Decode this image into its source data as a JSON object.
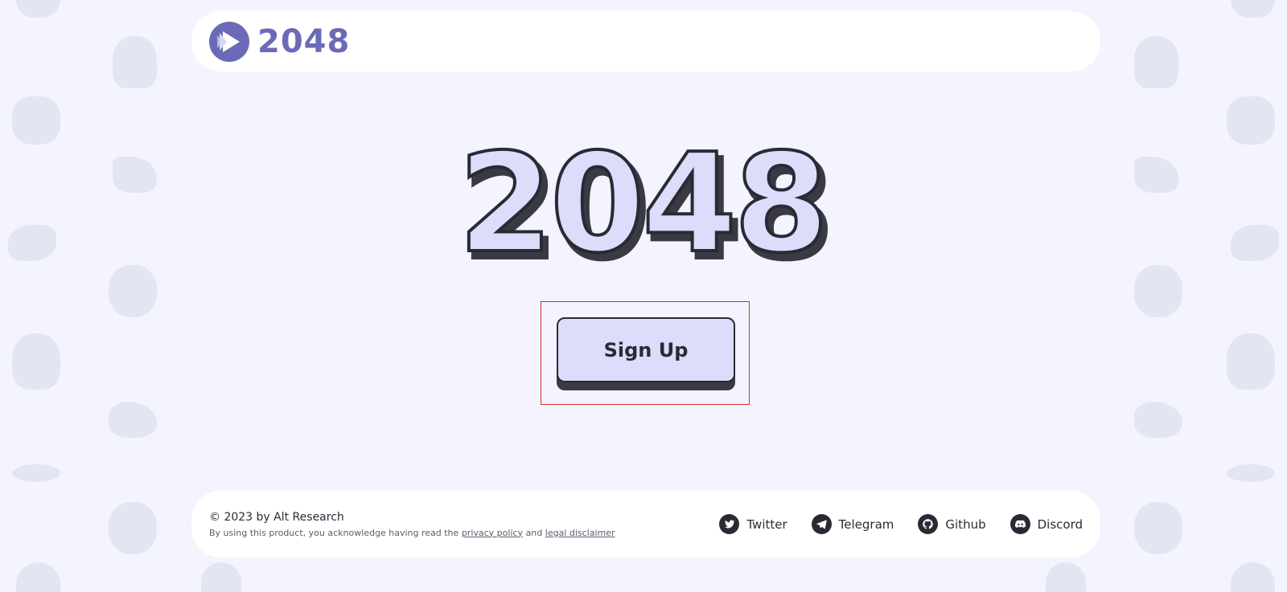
{
  "brand": {
    "logo_text": "2048",
    "logo_icon": "play-triangle-icon"
  },
  "hero": {
    "title": "2048"
  },
  "signup": {
    "label": "Sign Up"
  },
  "footer": {
    "copyright": "© 2023 by Alt Research",
    "disclaimer_prefix": "By using this product, you acknowledge having read the",
    "privacy_link": "privacy policy",
    "and_text": "and",
    "legal_link": "legal disclaimer",
    "social": [
      {
        "label": "Twitter",
        "icon": "twitter-icon"
      },
      {
        "label": "Telegram",
        "icon": "telegram-icon"
      },
      {
        "label": "Github",
        "icon": "github-icon"
      },
      {
        "label": "Discord",
        "icon": "discord-icon"
      }
    ]
  },
  "colors": {
    "background": "#f3f4fd",
    "brand": "#6b6ab7",
    "button_fill": "#dcdcfb",
    "ink": "#2a2a35",
    "highlight": "#d62b2b"
  }
}
